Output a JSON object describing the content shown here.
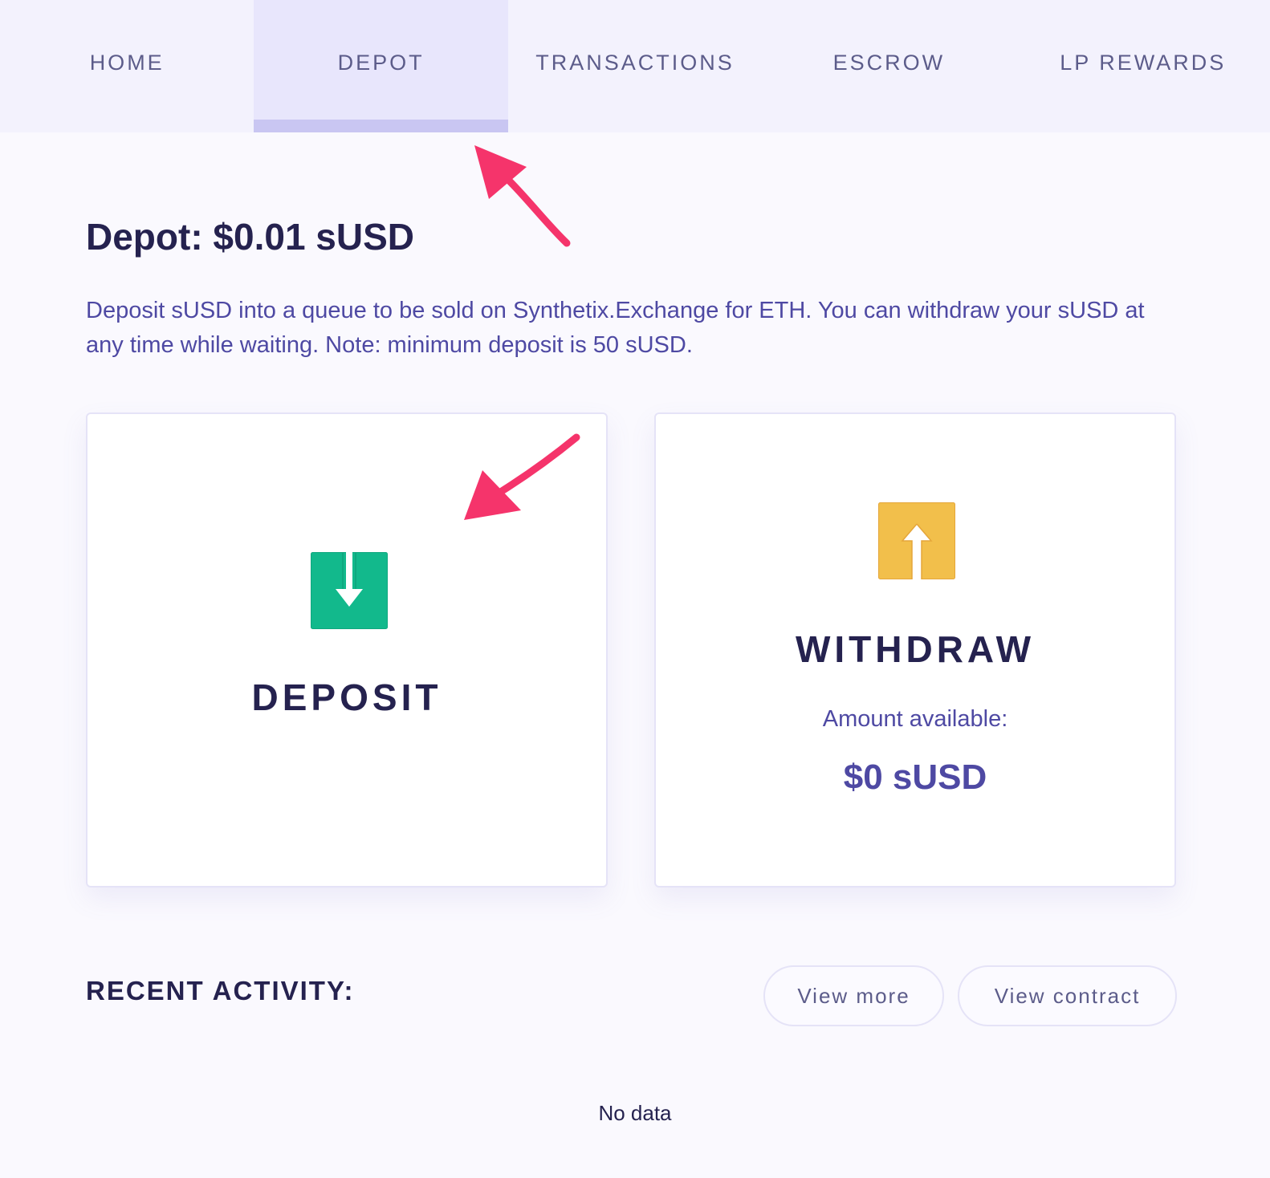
{
  "nav": {
    "tabs": [
      {
        "label": "HOME"
      },
      {
        "label": "DEPOT"
      },
      {
        "label": "TRANSACTIONS"
      },
      {
        "label": "ESCROW"
      },
      {
        "label": "LP REWARDS"
      }
    ],
    "active_tab": "DEPOT"
  },
  "depot": {
    "title": "Depot: $0.01 sUSD",
    "description": "Deposit sUSD into a queue to be sold on Synthetix.Exchange for ETH. You can withdraw your sUSD at any time while waiting. Note: minimum deposit is 50 sUSD."
  },
  "deposit_card": {
    "label": "DEPOSIT",
    "icon": "arrow-down-box-icon",
    "icon_color": "#12b98c"
  },
  "withdraw_card": {
    "label": "WITHDRAW",
    "icon": "arrow-up-box-icon",
    "icon_color": "#f2bf4b",
    "amount_label": "Amount available:",
    "amount_value": "$0 sUSD"
  },
  "recent_activity": {
    "title": "RECENT ACTIVITY:",
    "view_more_label": "View more",
    "view_contract_label": "View contract",
    "empty_text": "No data"
  },
  "annotation_color": "#f5346b"
}
